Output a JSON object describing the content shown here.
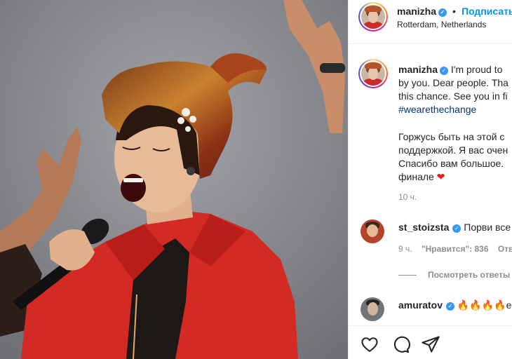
{
  "post": {
    "username": "manizha",
    "follow_label": "Подписаться",
    "separator": "•",
    "location": "Rotterdam, Netherlands",
    "verified_glyph": "✓"
  },
  "caption": {
    "username": "manizha",
    "en_line1": "I'm proud to",
    "en_line2": "by you. Dear people. Tha",
    "en_line3": "this chance. See you in fi",
    "hashtag": "#wearethechange",
    "ru_line1": "Горжусь быть на этой с",
    "ru_line2": "поддержкой. Я вас очен",
    "ru_line3": "Спасибо вам большое.",
    "ru_line4": "финале",
    "heart": "❤",
    "time": "10 ч."
  },
  "comments": [
    {
      "username": "st_stoizsta",
      "text": "Порви все",
      "time": "9 ч.",
      "likes_label": "\"Нравится\": 836",
      "reply_label": "Отв",
      "view_replies": "Посмотреть ответы"
    },
    {
      "username": "amuratov",
      "text": "🔥🔥🔥🔥ее"
    }
  ],
  "icons": {
    "like": "heart-icon",
    "comment": "comment-icon",
    "share": "share-icon",
    "verified": "verified-icon"
  },
  "colors": {
    "link_blue": "#0095f6",
    "verified_blue": "#3897f0",
    "hashtag": "#00376b",
    "muted": "#8e8e8e",
    "jacket_red": "#d42a24"
  }
}
